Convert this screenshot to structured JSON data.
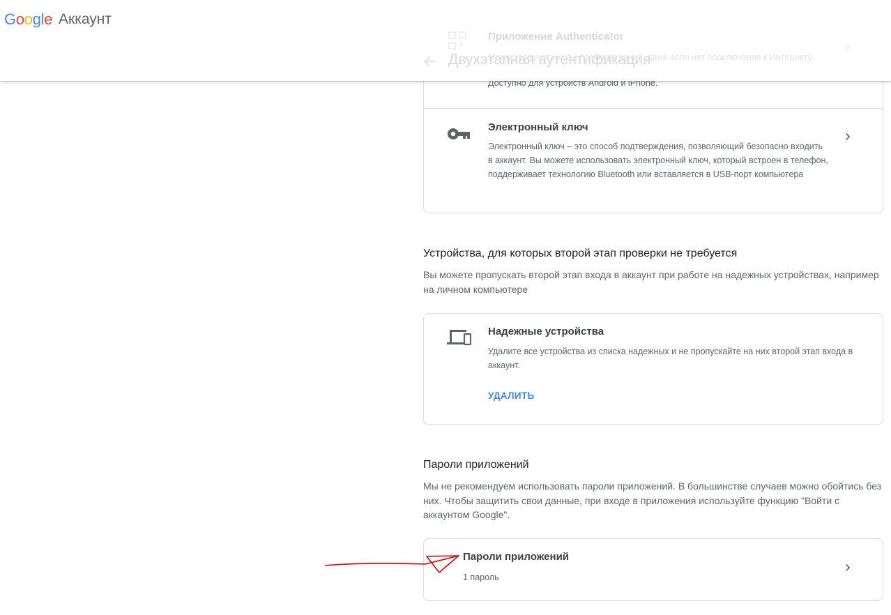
{
  "header": {
    "logo_text": "Google",
    "product_name": "Аккаунт",
    "page_title": "Двухэтапная аутентификация"
  },
  "authenticator": {
    "title": "Приложение Authenticator",
    "description": "Можно получать коды подтверждения, даже если нет подключения к Интернету.",
    "availability": "Доступно для устройств Android и iPhone."
  },
  "security_key": {
    "title": "Электронный ключ",
    "description": "Электронный ключ – это способ подтверждения, позволяющий безопасно входить в аккаунт. Вы можете использовать электронный ключ, который встроен в телефон, поддерживает технологию Bluetooth или вставляется в USB-порт компьютера"
  },
  "trusted_section": {
    "title": "Устройства, для которых второй этап проверки не требуется",
    "description": "Вы можете пропускать второй этап входа в аккаунт при работе на надежных устройствах, например на личном компьютере"
  },
  "trusted_devices": {
    "title": "Надежные устройства",
    "description": "Удалите все устройства из списка надежных и не пропускайте на них второй этап входа в аккаунт.",
    "action_label": "УДАЛИТЬ"
  },
  "app_passwords_section": {
    "title": "Пароли приложений",
    "description": "Мы не рекомендуем использовать пароли приложений. В большинстве случаев можно обойтись без них. Чтобы защитить свои данные, при входе в приложения используйте функцию \"Войти с аккаунтом Google\"."
  },
  "app_passwords_card": {
    "title": "Пароли приложений",
    "count_text": "1 пароль"
  },
  "colors": {
    "accent": "#1a73e8",
    "text_primary": "#202124",
    "text_secondary": "#5f6368",
    "border": "#dadce0",
    "annotation": "#e00000"
  }
}
